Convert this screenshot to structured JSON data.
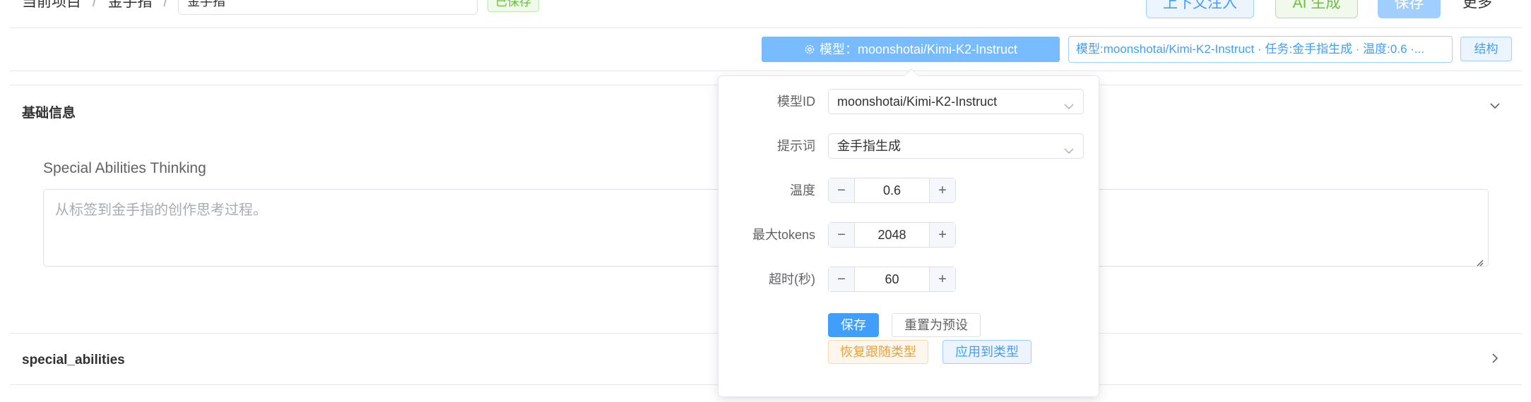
{
  "breadcrumb": {
    "item1": "当前项目",
    "sep": "/",
    "item2": "金手指"
  },
  "name_input": {
    "value": "金手指"
  },
  "saved_tag": "已保存",
  "toolbar": {
    "context_label": "上下文注入",
    "ai_label": "AI 生成",
    "save_label": "保存",
    "more_label": "更多"
  },
  "model_bar": {
    "model_button_label": "模型：moonshotai/Kimi-K2-Instruct",
    "summary": "模型:moonshotai/Kimi-K2-Instruct · 任务:金手指生成 · 温度:0.6 ·...",
    "struct_label": "结构"
  },
  "sections": {
    "basic_title": "基础信息",
    "field_label": "Special Abilities Thinking",
    "field_placeholder": "从标签到金手指的创作思考过程。",
    "special_title": "special_abilities"
  },
  "popover": {
    "model_id_label": "模型ID",
    "model_id_value": "moonshotai/Kimi-K2-Instruct",
    "prompt_label": "提示词",
    "prompt_value": "金手指生成",
    "temperature_label": "温度",
    "temperature_value": "0.6",
    "max_tokens_label": "最大tokens",
    "max_tokens_value": "2048",
    "timeout_label": "超时(秒)",
    "timeout_value": "60",
    "minus": "−",
    "plus": "+",
    "save_label": "保存",
    "reset_label": "重置为预设",
    "restore_label": "恢复跟随类型",
    "apply_label": "应用到类型"
  },
  "colors": {
    "primary": "#409eff",
    "success": "#67c23a",
    "warning": "#e6a23c",
    "border": "#dcdfe6"
  }
}
